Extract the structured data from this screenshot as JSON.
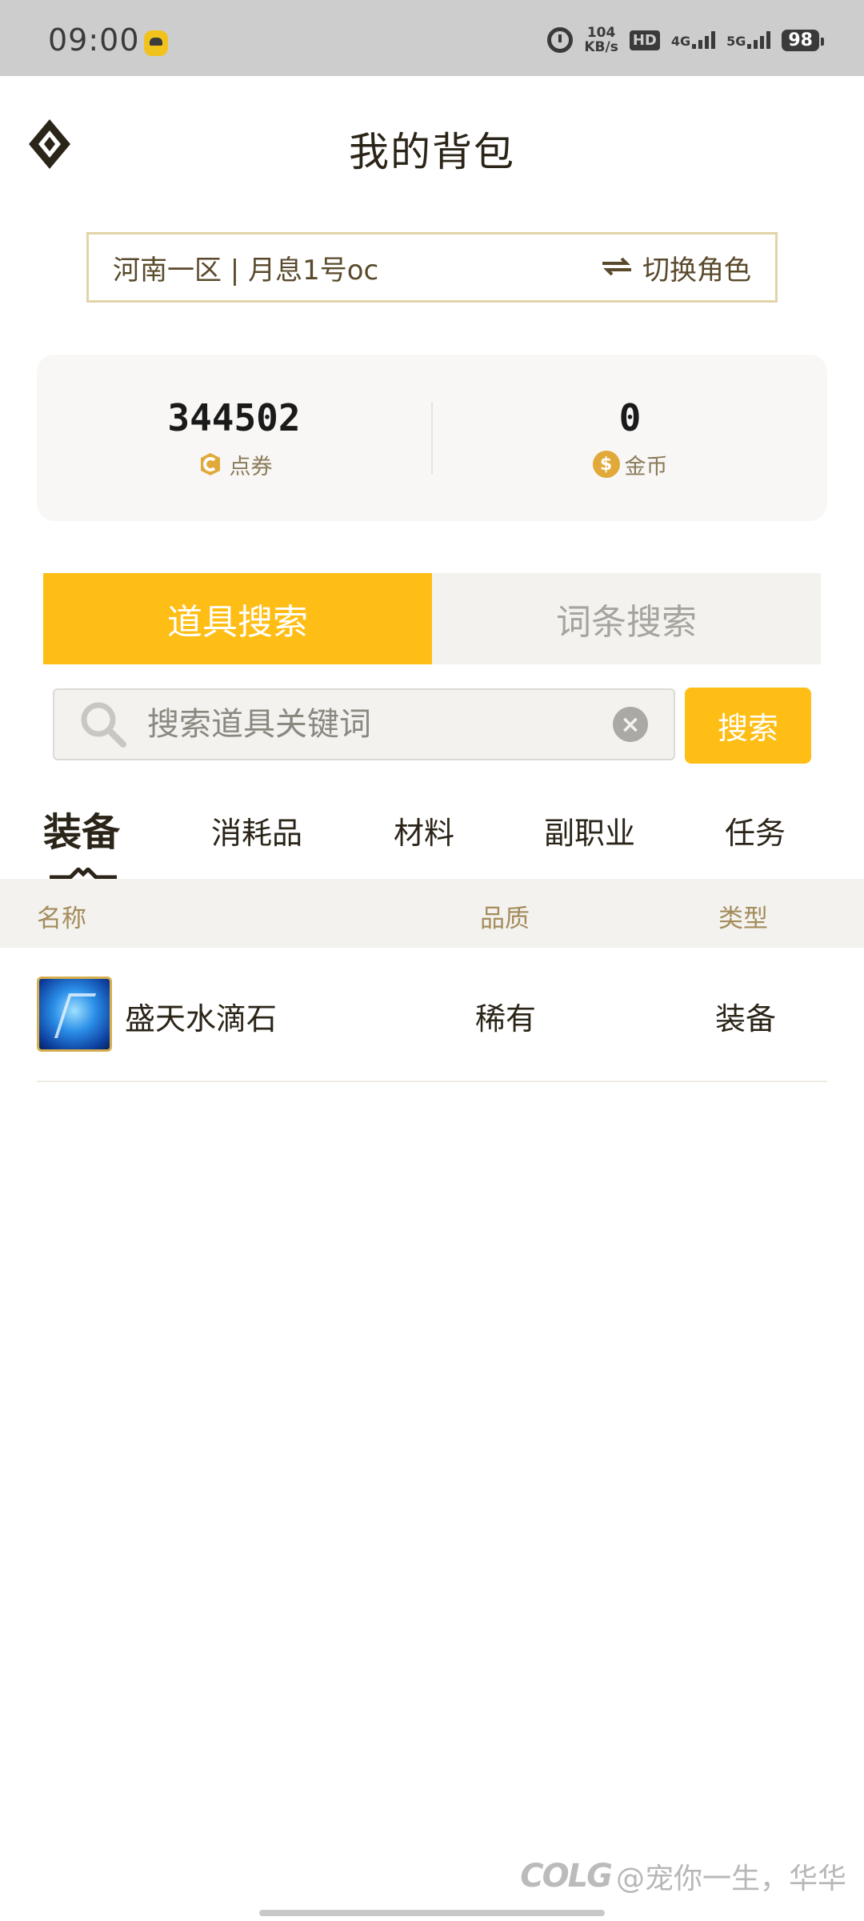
{
  "status_bar": {
    "time": "09:00",
    "net_speed_value": "104",
    "net_speed_unit": "KB/s",
    "hd": "HD",
    "sim1": "4G",
    "sim2": "5G",
    "battery": "98"
  },
  "header": {
    "title": "我的背包"
  },
  "server": {
    "label": "河南一区 | 月息1号oc",
    "switch_label": "切换角色"
  },
  "currency": {
    "voucher_value": "344502",
    "voucher_label": "点券",
    "gold_value": "0",
    "gold_label": "金币",
    "gold_symbol": "$"
  },
  "search_tabs": [
    {
      "label": "道具搜索",
      "active": true
    },
    {
      "label": "词条搜索",
      "active": false
    }
  ],
  "search": {
    "placeholder": "搜索道具关键词",
    "button_label": "搜索",
    "clear_symbol": "×"
  },
  "categories": [
    {
      "label": "装备",
      "active": true
    },
    {
      "label": "消耗品",
      "active": false
    },
    {
      "label": "材料",
      "active": false
    },
    {
      "label": "副职业",
      "active": false
    },
    {
      "label": "任务",
      "active": false
    }
  ],
  "table": {
    "columns": [
      "名称",
      "品质",
      "类型"
    ],
    "rows": [
      {
        "name": "盛天水滴石",
        "quality": "稀有",
        "type": "装备"
      }
    ]
  },
  "watermark": {
    "logo": "COLG",
    "text": "@宠你一生，华华"
  },
  "colors": {
    "accent": "#ffbe15",
    "tab_inactive_bg": "#f3f2ef",
    "border_gold": "#e2d4a8",
    "header_text": "#a48c5c"
  }
}
